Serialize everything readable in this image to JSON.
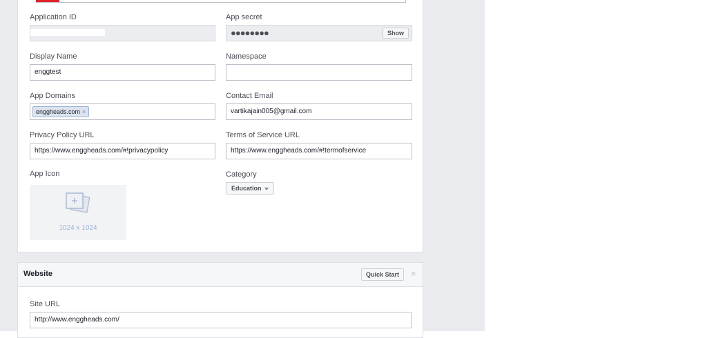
{
  "basic_settings": {
    "application_id": {
      "label": "Application ID",
      "value": ""
    },
    "app_secret": {
      "label": "App secret",
      "value": "●●●●●●●●",
      "show_label": "Show"
    },
    "display_name": {
      "label": "Display Name",
      "value": "enggtest"
    },
    "namespace": {
      "label": "Namespace",
      "value": ""
    },
    "app_domains": {
      "label": "App Domains",
      "tags": [
        "enggheads.com"
      ],
      "remove_glyph": "×"
    },
    "contact_email": {
      "label": "Contact Email",
      "value": "vartikajain005@gmail.com"
    },
    "privacy_policy_url": {
      "label": "Privacy Policy URL",
      "value": "https://www.enggheads.com/#!privacypolicy"
    },
    "terms_of_service_url": {
      "label": "Terms of Service URL",
      "value": "https://www.enggheads.com/#!termofservice"
    },
    "app_icon": {
      "label": "App Icon",
      "size_text": "1024 x 1024",
      "icon": "image-upload-icon"
    },
    "category": {
      "label": "Category",
      "selected": "Education"
    }
  },
  "website": {
    "title": "Website",
    "quick_start_label": "Quick Start",
    "close_glyph": "×",
    "site_url": {
      "label": "Site URL",
      "value": "http://www.enggheads.com/"
    }
  },
  "colors": {
    "page_bg": "#e9ebee",
    "card_border": "#dddfe2",
    "input_border": "#bdc1c9",
    "tag_bg": "#dce3ee",
    "tag_border": "#9cb4d8",
    "accent_red": "#e0212a"
  }
}
